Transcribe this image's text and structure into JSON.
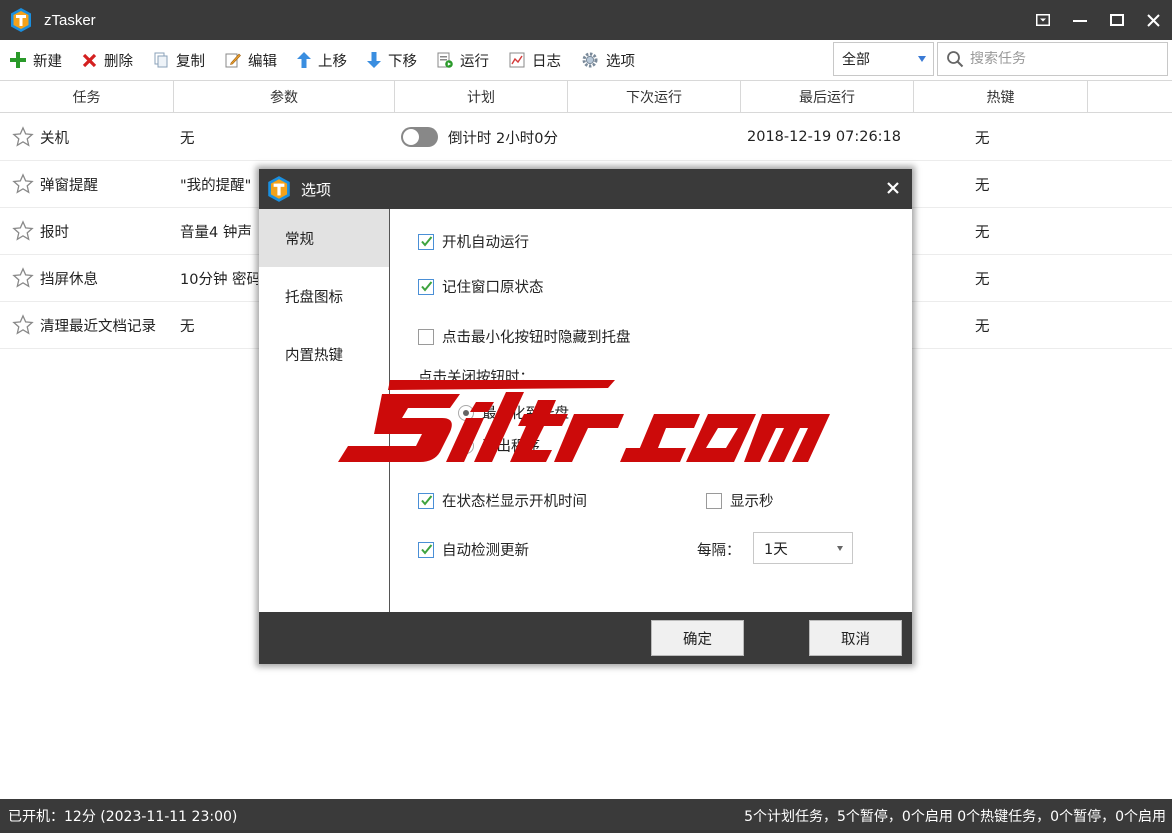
{
  "window": {
    "title": "zTasker"
  },
  "toolbar": {
    "new_label": "新建",
    "delete_label": "删除",
    "copy_label": "复制",
    "edit_label": "编辑",
    "move_up_label": "上移",
    "move_down_label": "下移",
    "run_label": "运行",
    "log_label": "日志",
    "options_label": "选项",
    "filter_value": "全部",
    "search_placeholder": "搜索任务"
  },
  "table": {
    "columns": [
      "任务",
      "参数",
      "计划",
      "下次运行",
      "最后运行",
      "热键"
    ],
    "rows": [
      {
        "task": "关机",
        "params": "无",
        "plan": "倒计时 2小时0分",
        "next": "",
        "last": "2018-12-19 07:26:18",
        "hotkey": "无"
      },
      {
        "task": "弹窗提醒",
        "params": "\"我的提醒\"",
        "plan": "",
        "next": "",
        "last": "",
        "hotkey": "无"
      },
      {
        "task": "报时",
        "params": "音量4 钟声",
        "plan": "",
        "next": "",
        "last": "",
        "hotkey": "无"
      },
      {
        "task": "挡屏休息",
        "params": "10分钟 密码",
        "plan": "",
        "next": "",
        "last": "",
        "hotkey": "无"
      },
      {
        "task": "清理最近文档记录",
        "params": "无",
        "plan": "",
        "next": "",
        "last": "",
        "hotkey": "无"
      }
    ]
  },
  "status": {
    "left": "已开机：12分 (2023-11-11 23:00)",
    "right": "5个计划任务，5个暂停，0个启用   0个热键任务，0个暂停，0个启用"
  },
  "dialog": {
    "title": "选项",
    "sidebar": [
      "常规",
      "托盘图标",
      "内置热键"
    ],
    "options": {
      "autostart": "开机自动运行",
      "remember_window": "记住窗口原状态",
      "minimize_to_tray": "点击最小化按钮时隐藏到托盘",
      "close_label": "点击关闭按钮时：",
      "close_minimize": "最小化到托盘",
      "close_exit": "退出程序",
      "show_uptime": "在状态栏显示开机时间",
      "show_seconds": "显示秒",
      "auto_update": "自动检测更新",
      "interval_label": "每隔：",
      "interval_value": "1天"
    },
    "ok_label": "确定",
    "cancel_label": "取消"
  },
  "watermark": {
    "text": "5iltr.com"
  },
  "colors": {
    "titlebar": "#3a3a3a",
    "accent_blue": "#1a8fe0",
    "watermark_red": "#cc0a0a"
  }
}
